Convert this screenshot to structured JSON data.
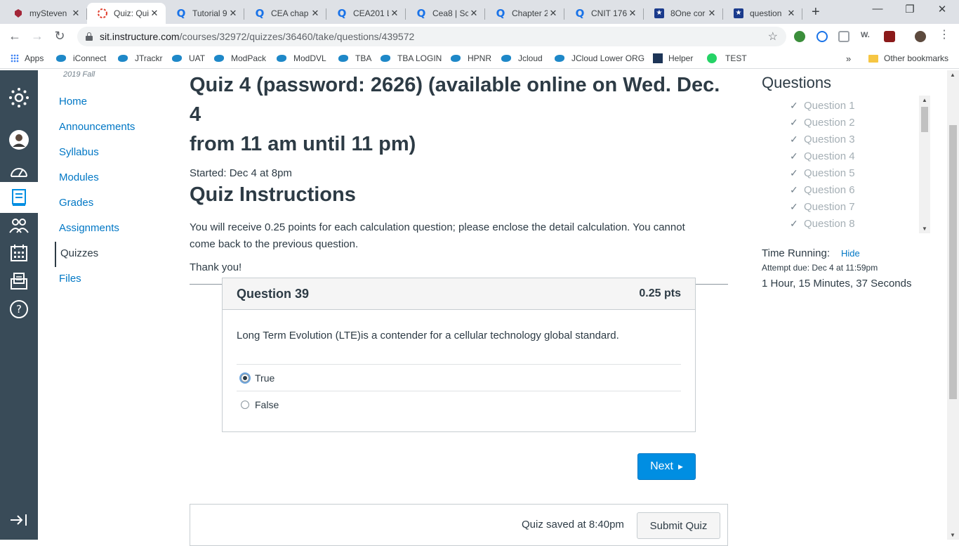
{
  "browser": {
    "tabs": [
      {
        "title": "mySteven",
        "icon": "stevens-icon",
        "active": false
      },
      {
        "title": "Quiz: Qui",
        "icon": "canvas-icon",
        "active": true
      },
      {
        "title": "Tutorial 9",
        "icon": "q-icon",
        "active": false
      },
      {
        "title": "CEA chap",
        "icon": "q-icon",
        "active": false
      },
      {
        "title": "CEA201 L",
        "icon": "q-icon",
        "active": false
      },
      {
        "title": "Cea8 | Sc",
        "icon": "q-icon",
        "active": false
      },
      {
        "title": "Chapter 2",
        "icon": "q-icon",
        "active": false
      },
      {
        "title": "CNIT 176",
        "icon": "q-icon",
        "active": false
      },
      {
        "title": "8One cor",
        "icon": "star-icon",
        "active": false
      },
      {
        "title": "question",
        "icon": "star-icon",
        "active": false
      }
    ],
    "url_host": "sit.instructure.com",
    "url_path": "/courses/32972/quizzes/36460/take/questions/439572",
    "bookmarks": [
      "Apps",
      "iConnect",
      "JTrackr",
      "UAT",
      "ModPack",
      "ModDVL",
      "TBA",
      "TBA LOGIN",
      "HPNR",
      "Jcloud",
      "JCloud Lower ORG",
      "Helper",
      "TEST"
    ],
    "more_bookmarks": "»",
    "other_bookmarks": "Other bookmarks"
  },
  "course": {
    "term": "2019 Fall",
    "nav": [
      "Home",
      "Announcements",
      "Syllabus",
      "Modules",
      "Grades",
      "Assignments",
      "Quizzes",
      "Files"
    ],
    "active_nav": "Quizzes"
  },
  "quiz": {
    "title_line1": "Quiz 4 (password: 2626) (available online on Wed. Dec. 4",
    "title_line2": "from 11 am until 11 pm)",
    "started": "Started: Dec 4 at 8pm",
    "instructions_heading": "Quiz Instructions",
    "instructions_text_line1": "You will receive 0.25 points for each calculation question; please enclose the detail calculation. You cannot",
    "instructions_text_line2": "come back to the previous question.",
    "thanks": "Thank you!",
    "question": {
      "number_label": "Question 39",
      "points": "0.25 pts",
      "text": "Long Term Evolution (LTE)is a contender for a cellular technology global standard.",
      "answers": [
        "True",
        "False"
      ],
      "selected": "True"
    },
    "next_label": "Next",
    "saved_text": "Quiz saved at 8:40pm",
    "submit_label": "Submit Quiz"
  },
  "sidebar": {
    "heading": "Questions",
    "questions": [
      "Question 1",
      "Question 2",
      "Question 3",
      "Question 4",
      "Question 5",
      "Question 6",
      "Question 7",
      "Question 8"
    ],
    "time_running_label": "Time Running:",
    "hide_label": "Hide",
    "attempt_due": "Attempt due: Dec 4 at 11:59pm",
    "timer": "1 Hour, 15 Minutes, 37 Seconds"
  }
}
